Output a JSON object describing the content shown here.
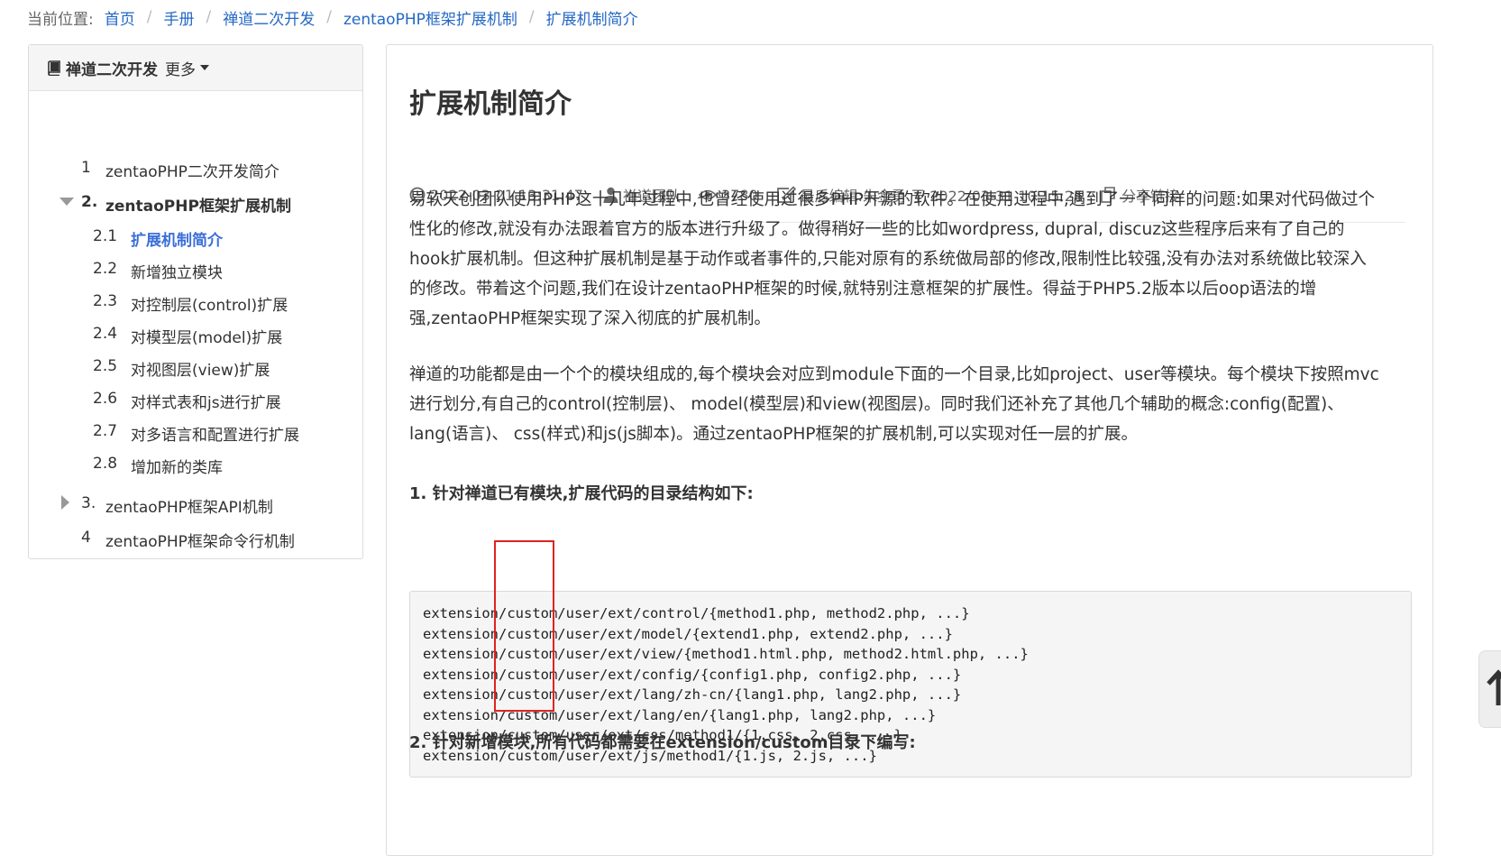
{
  "breadcrumb": {
    "label": "当前位置:",
    "items": [
      "首页",
      "手册",
      "禅道二次开发",
      "zentaoPHP框架扩展机制",
      "扩展机制简介"
    ]
  },
  "sidebar": {
    "title": "禅道二次开发",
    "more": "更多",
    "toc": [
      {
        "num": "1",
        "label": "zentaoPHP二次开发简介"
      },
      {
        "num": "2.",
        "label": "zentaoPHP框架扩展机制"
      },
      {
        "num": "2.1",
        "label": "扩展机制简介"
      },
      {
        "num": "2.2",
        "label": "新增独立模块"
      },
      {
        "num": "2.3",
        "label": "对控制层(control)扩展"
      },
      {
        "num": "2.4",
        "label": "对模型层(model)扩展"
      },
      {
        "num": "2.5",
        "label": "对视图层(view)扩展"
      },
      {
        "num": "2.6",
        "label": "对样式表和js进行扩展"
      },
      {
        "num": "2.7",
        "label": "对多语言和配置进行扩展"
      },
      {
        "num": "2.8",
        "label": "增加新的类库"
      },
      {
        "num": "3.",
        "label": "zentaoPHP框架API机制"
      },
      {
        "num": "4",
        "label": "zentaoPHP框架命令行机制"
      }
    ]
  },
  "article": {
    "title": "扩展机制简介",
    "meta": {
      "date": "2022-03-21 13:31:47",
      "author": "禅道团队",
      "views": "3780",
      "edited": "最后编辑:朱金勇 于 2022-03-31 10:15:26",
      "share": "分享链接"
    },
    "para1": "易软天创团队使用PHP这十几年过程中,也曾经使用过很多PHP开源的软件。在使用过程中,遇到了一个同样的问题:如果对代码做过个性化的修改,就没有办法跟着官方的版本进行升级了。做得稍好一些的比如wordpress, dupral, discuz这些程序后来有了自己的hook扩展机制。但这种扩展机制是基于动作或者事件的,只能对原有的系统做局部的修改,限制性比较强,没有办法对系统做比较深入的修改。带着这个问题,我们在设计zentaoPHP框架的时候,就特别注意框架的扩展性。得益于PHP5.2版本以后oop语法的增强,zentaoPHP框架实现了深入彻底的扩展机制。",
    "para2": "禅道的功能都是由一个个的模块组成的,每个模块会对应到module下面的一个目录,比如project、user等模块。每个模块下按照mvc进行划分,有自己的control(控制层)、 model(模型层)和view(视图层)。同时我们还补充了其他几个辅助的概念:config(配置)、lang(语言)、 css(样式)和js(js脚本)。通过zentaoPHP框架的扩展机制,可以实现对任一层的扩展。",
    "section1": "1. 针对禅道已有模块,扩展代码的目录结构如下:",
    "code": [
      "extension/custom/user/ext/control/{method1.php, method2.php, ...}",
      "extension/custom/user/ext/model/{extend1.php, extend2.php, ...}",
      "extension/custom/user/ext/view/{method1.html.php, method2.html.php, ...}",
      "extension/custom/user/ext/config/{config1.php, config2.php, ...}",
      "extension/custom/user/ext/lang/zh-cn/{lang1.php, lang2.php, ...}",
      "extension/custom/user/ext/lang/en/{lang1.php, lang2.php, ...}",
      "extension/custom/user/ext/css/method1/{1.css, 2.css, ...}",
      "extension/custom/user/ext/js/method1/{1.js, 2.js, ...}"
    ],
    "section2": "2. 针对新增模块,所有代码都需要在extension/custom目录下编写:"
  },
  "colors": {
    "link": "#2468c4",
    "active": "#3a6fd8",
    "highlight": "#e0231f"
  }
}
